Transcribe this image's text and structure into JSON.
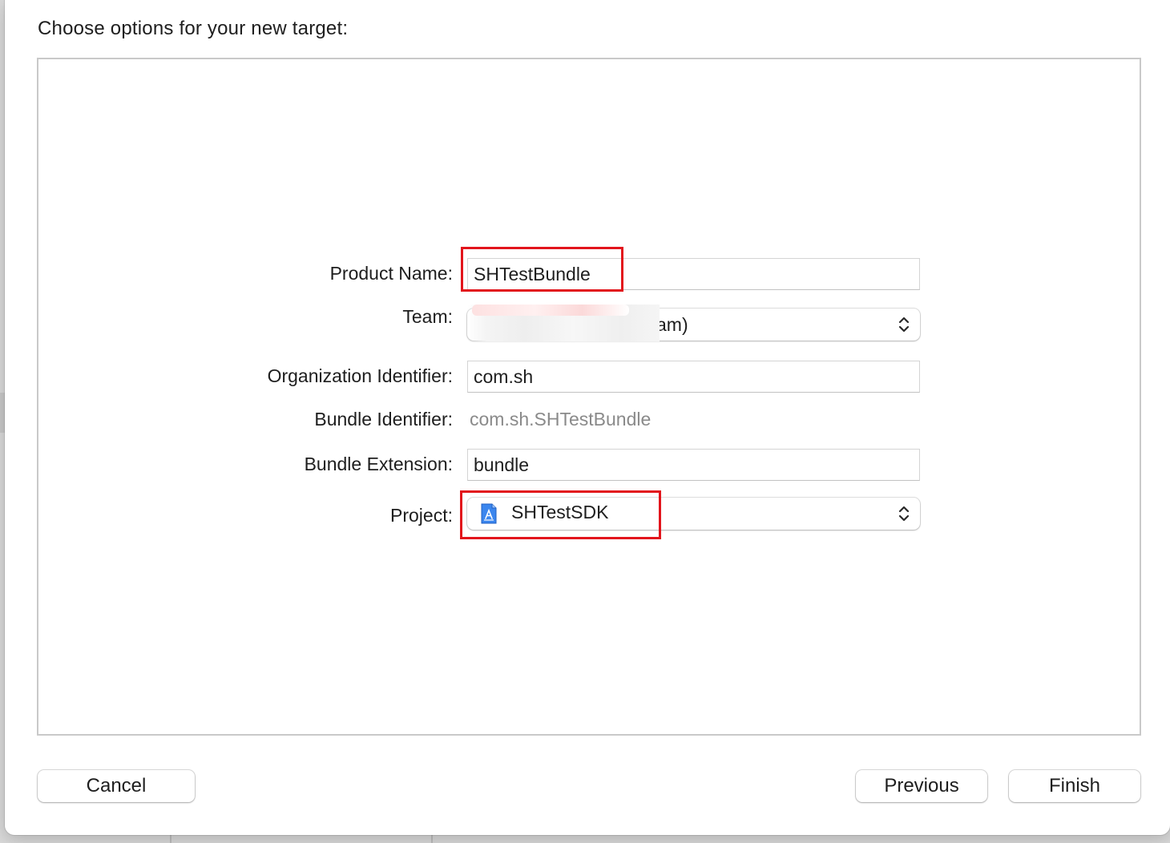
{
  "sheet": {
    "title": "Choose options for your new target:"
  },
  "form": {
    "product_name": {
      "label": "Product Name:",
      "value": "SHTestBundle"
    },
    "team": {
      "label": "Team:",
      "visible_value": "am)"
    },
    "organization_identifier": {
      "label": "Organization Identifier:",
      "value": "com.sh"
    },
    "bundle_identifier": {
      "label": "Bundle Identifier:",
      "value": "com.sh.SHTestBundle"
    },
    "bundle_extension": {
      "label": "Bundle Extension:",
      "value": "bundle"
    },
    "project": {
      "label": "Project:",
      "value": "SHTestSDK",
      "icon": "xcode-project-icon"
    }
  },
  "buttons": {
    "cancel": "Cancel",
    "previous": "Previous",
    "finish": "Finish"
  },
  "colors": {
    "highlight": "#e2151c",
    "placeholder_text": "#8a8a8a",
    "project_icon_blue": "#2f7ee8"
  }
}
